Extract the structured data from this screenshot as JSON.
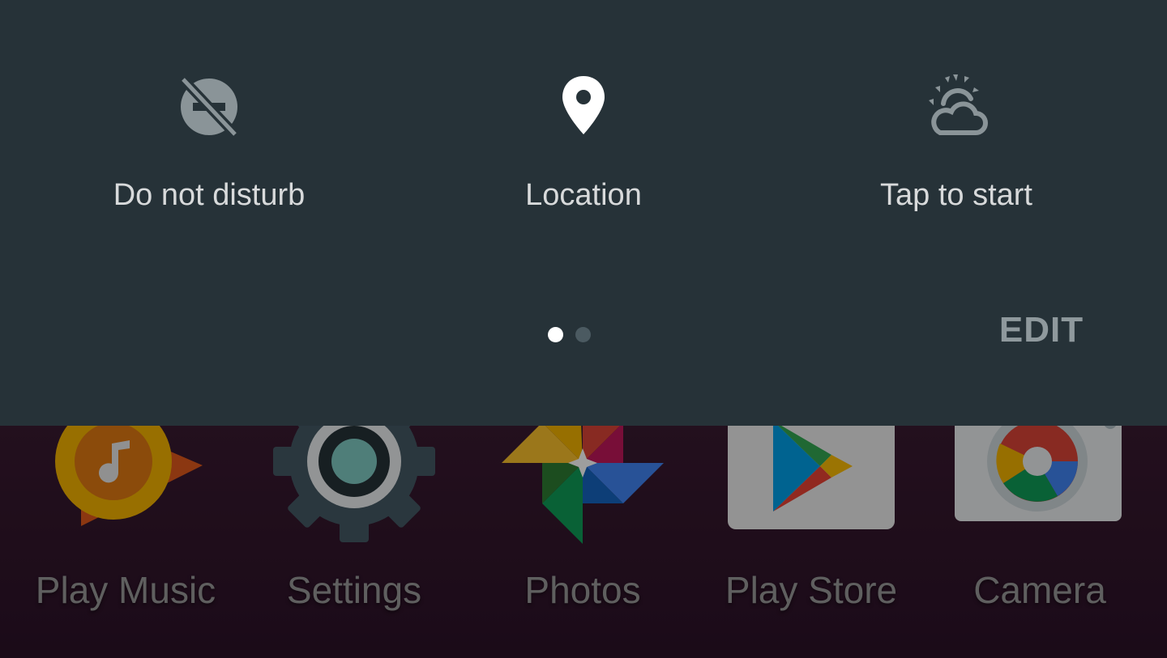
{
  "quick_settings": {
    "tiles": [
      {
        "label": "Do not disturb",
        "icon": "do-not-disturb-off-icon",
        "state": "off"
      },
      {
        "label": "Location",
        "icon": "location-pin-icon",
        "state": "on"
      },
      {
        "label": "Tap to start",
        "icon": "night-mode-icon",
        "state": "off"
      }
    ],
    "pager": {
      "pages": 2,
      "current": 1
    },
    "edit_label": "EDIT"
  },
  "dock": {
    "apps": [
      {
        "label": "Play Music",
        "icon": "play-music-icon"
      },
      {
        "label": "Settings",
        "icon": "settings-gear-icon"
      },
      {
        "label": "Photos",
        "icon": "photos-pinwheel-icon"
      },
      {
        "label": "Play Store",
        "icon": "play-store-icon"
      },
      {
        "label": "Camera",
        "icon": "camera-icon"
      }
    ]
  },
  "colors": {
    "panel": "#263238",
    "tile_on": "#ffffff",
    "tile_off": "#8a9498",
    "label": "#d8dadb"
  }
}
